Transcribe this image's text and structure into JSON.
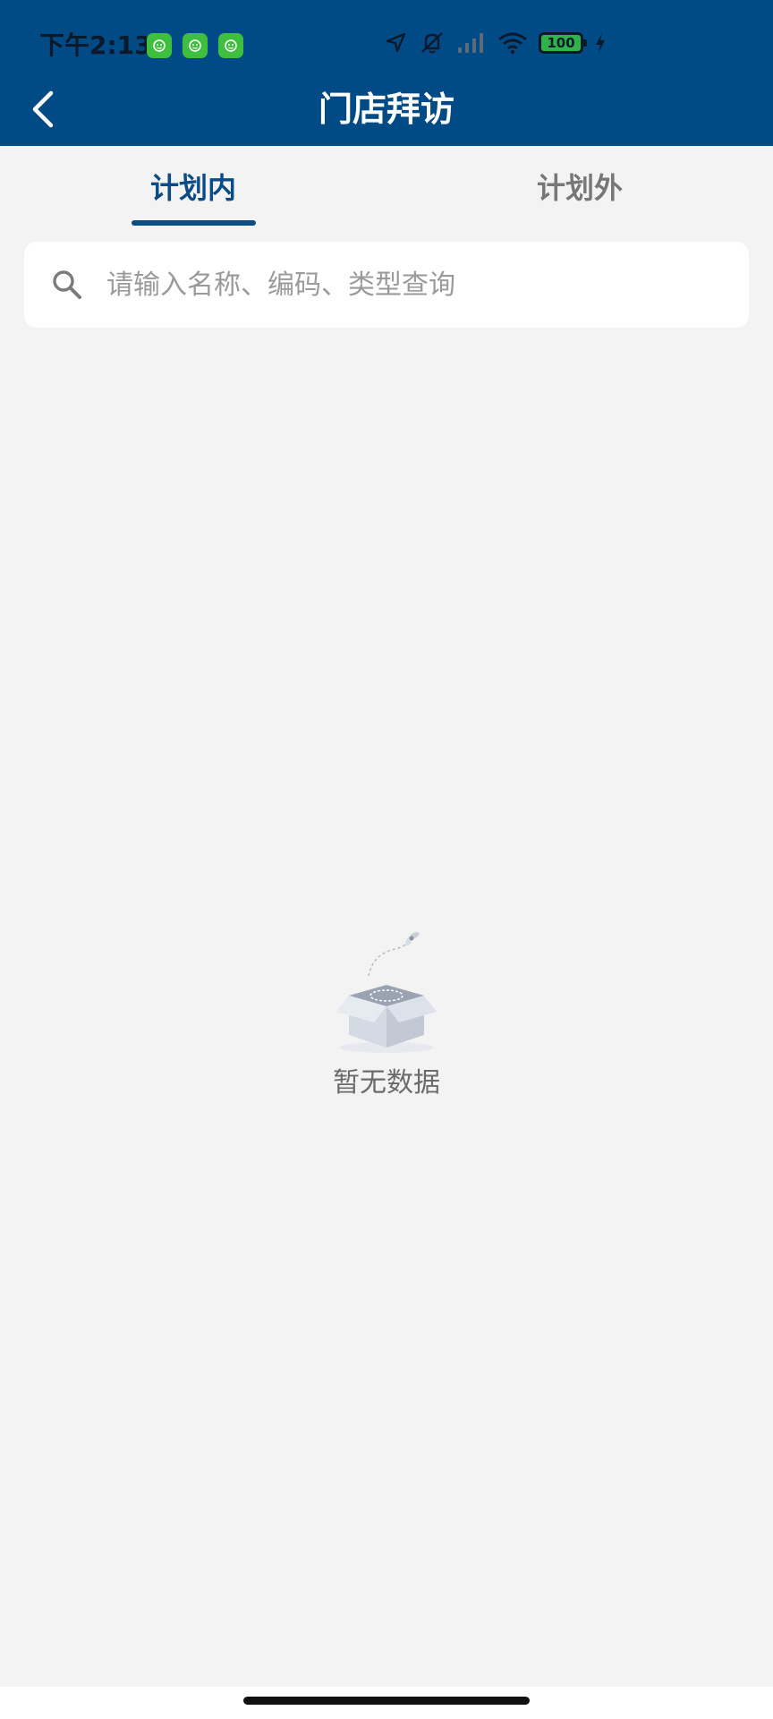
{
  "status_bar": {
    "time": "下午2:13",
    "battery": "100",
    "notification_icons": [
      "app-notification-icon",
      "app-notification-icon",
      "app-notification-icon"
    ]
  },
  "header": {
    "title": "门店拜访",
    "background_color": "#004a86"
  },
  "tabs": [
    {
      "label": "计划内",
      "active": true
    },
    {
      "label": "计划外",
      "active": false
    }
  ],
  "search": {
    "placeholder": "请输入名称、编码、类型查询",
    "value": ""
  },
  "empty_state": {
    "text": "暂无数据",
    "icon": "empty-box-icon"
  },
  "colors": {
    "accent": "#0b4b86",
    "background": "#f3f3f4"
  }
}
